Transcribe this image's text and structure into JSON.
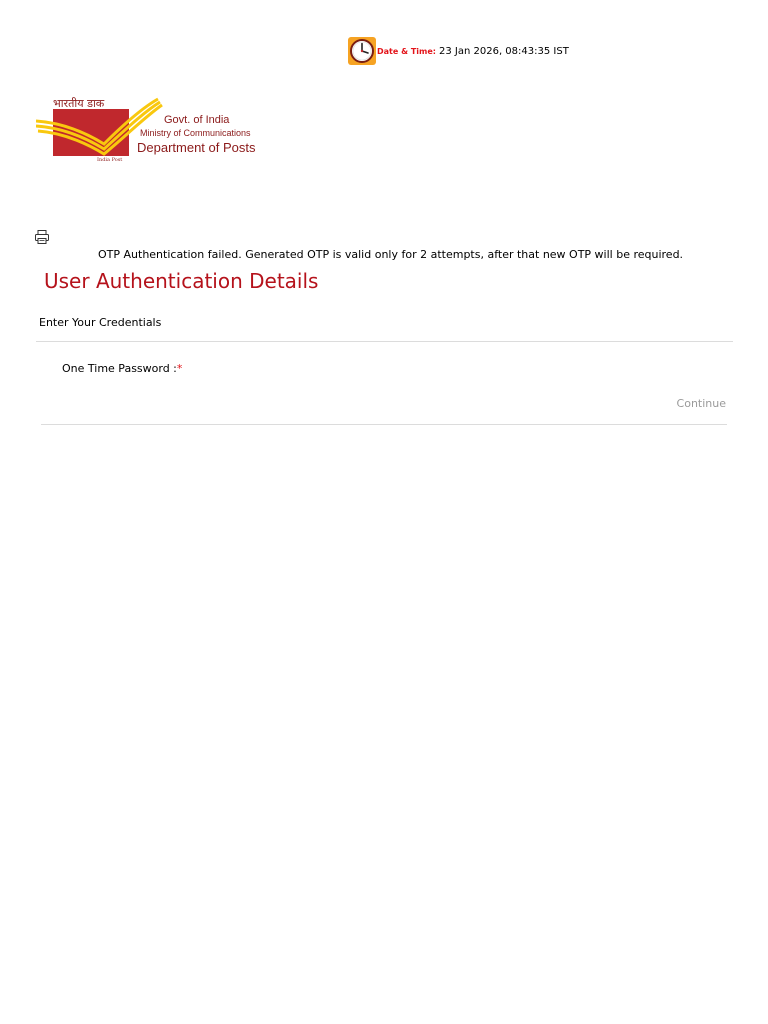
{
  "header": {
    "datetime_label": "Date & Time:",
    "datetime_value": "23 Jan 2026, 08:43:35 IST",
    "clock_icon": "clock-icon"
  },
  "logo": {
    "hindi_text": "भारतीय डाक",
    "line1": "Govt. of India",
    "line2": "Ministry of Communications",
    "line3": "Department of Posts",
    "small_text": "India Post",
    "colors": {
      "red": "#c0282d",
      "yellow": "#f9c80e",
      "text": "#8b1a1a"
    }
  },
  "toolbar": {
    "print_icon": "printer-icon"
  },
  "alert": {
    "message": "OTP Authentication failed. Generated OTP is valid only for 2 attempts, after that new OTP will be required."
  },
  "page": {
    "title": "User Authentication Details",
    "section_heading": "Enter Your Credentials"
  },
  "form": {
    "otp_label": "One Time Password :",
    "required_marker": "*",
    "otp_value": "",
    "continue_label": "Continue"
  },
  "colors": {
    "title": "#b5121b",
    "required": "#e3141a",
    "datetime_label": "#e3141a",
    "clock_bg": "#f6a323",
    "continue_text": "#9a9a9a",
    "divider": "#dcdcdc"
  }
}
